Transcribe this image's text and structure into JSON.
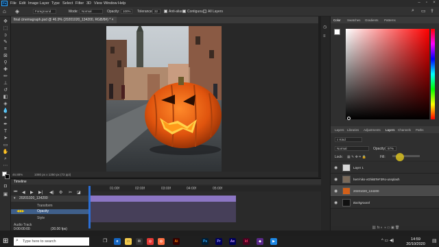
{
  "menu": [
    "File",
    "Edit",
    "Image",
    "Layer",
    "Type",
    "Select",
    "Filter",
    "3D",
    "View",
    "Window",
    "Help"
  ],
  "options": {
    "fill_source": "Foreground",
    "mode_label": "Mode:",
    "mode_value": "Normal",
    "opacity_label": "Opacity:",
    "opacity_value": "100%",
    "tolerance_label": "Tolerance:",
    "tolerance_value": "32",
    "anti_alias_label": "Anti-alias",
    "contiguous_label": "Contiguous",
    "all_layers_label": "All Layers"
  },
  "document": {
    "tab_title": "final cinemagraph.psd @ 46.9% (20201020_134200, RGB/8#) *",
    "zoom": "46.88%",
    "dimensions": "1080 px x 1350 px (72 ppi)"
  },
  "timeline": {
    "title": "Timeline",
    "ticks": [
      "01:00f",
      "02:00f",
      "03:00f",
      "04:00f",
      "05:00f"
    ],
    "track_name": "20201020_134200",
    "props": [
      "Transform",
      "Opacity",
      "Style"
    ],
    "audio_track_label": "Audio Track",
    "timecode": "0:00:00:00",
    "fps": "(30.00 fps)"
  },
  "color_panel": {
    "tabs": [
      "Color",
      "Swatches",
      "Gradients",
      "Patterns"
    ],
    "hue_color": "#ff0000"
  },
  "layers_panel": {
    "tabs": [
      "Layers",
      "Libraries",
      "Adjustments",
      "Layers",
      "Channels",
      "Paths"
    ],
    "kind_label": "Kind",
    "blend_mode": "Normal",
    "opacity_label": "Opacity:",
    "opacity_value": "97%",
    "lock_label": "Lock:",
    "fill_label": "Fill:",
    "layers": [
      {
        "name": "Layer 1",
        "selected": false
      },
      {
        "name": "hert-hiks-vGhkBTeF3Ro-unsplash",
        "selected": false
      },
      {
        "name": "20201020_134200",
        "selected": true
      },
      {
        "name": "Background",
        "selected": false
      }
    ]
  },
  "taskbar": {
    "search_placeholder": "Type here to search",
    "time": "14:59",
    "date": "20/10/2020",
    "apps": [
      {
        "name": "Ai",
        "color": "#ff7c00"
      },
      {
        "name": "Ps",
        "color": "#31a8ff"
      },
      {
        "name": "Pr",
        "color": "#9999ff"
      },
      {
        "name": "Ae",
        "color": "#9999ff"
      },
      {
        "name": "Id",
        "color": "#ff3366"
      }
    ]
  }
}
